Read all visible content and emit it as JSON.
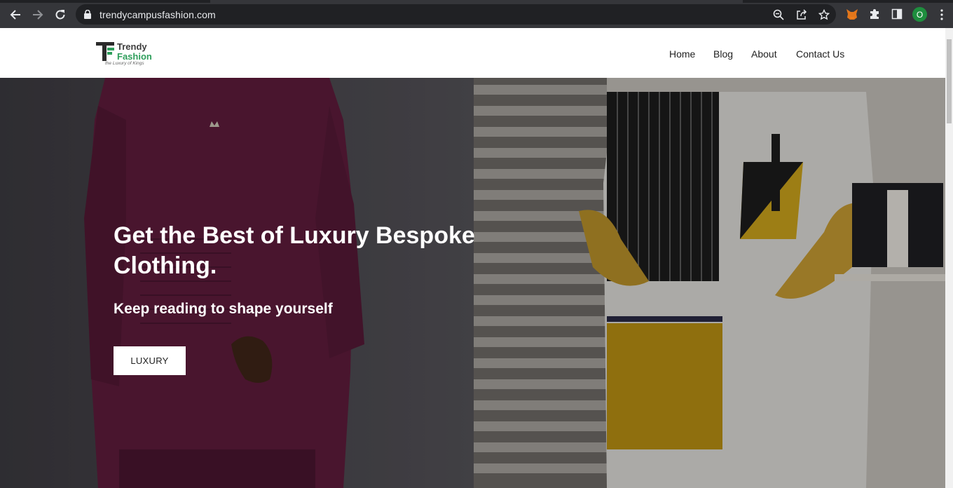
{
  "browser": {
    "url": "trendycampusfashion.com",
    "profile_initial": "O",
    "icons": [
      "back-icon",
      "forward-icon",
      "reload-icon",
      "lock-icon",
      "zoom-icon",
      "share-icon",
      "bookmark-star-icon",
      "metamask-fox-icon",
      "extensions-puzzle-icon",
      "side-panel-icon",
      "kebab-menu-icon"
    ]
  },
  "site": {
    "logo": {
      "line1": "Trendy",
      "line2": "Fashion",
      "tagline": "the Luxury of Kings"
    },
    "nav": [
      "Home",
      "Blog",
      "About",
      "Contact Us"
    ]
  },
  "hero": {
    "title": "Get the Best of Luxury Bespoke Clothing.",
    "subtitle": "Keep reading to shape yourself",
    "button": "LUXURY"
  },
  "colors": {
    "chrome_bg": "#35363a",
    "omnibox_bg": "#202124",
    "brand_green": "#2e9e5b",
    "shirt_maroon": "#5e1c3c",
    "accent_mustard": "#c9a21c"
  }
}
